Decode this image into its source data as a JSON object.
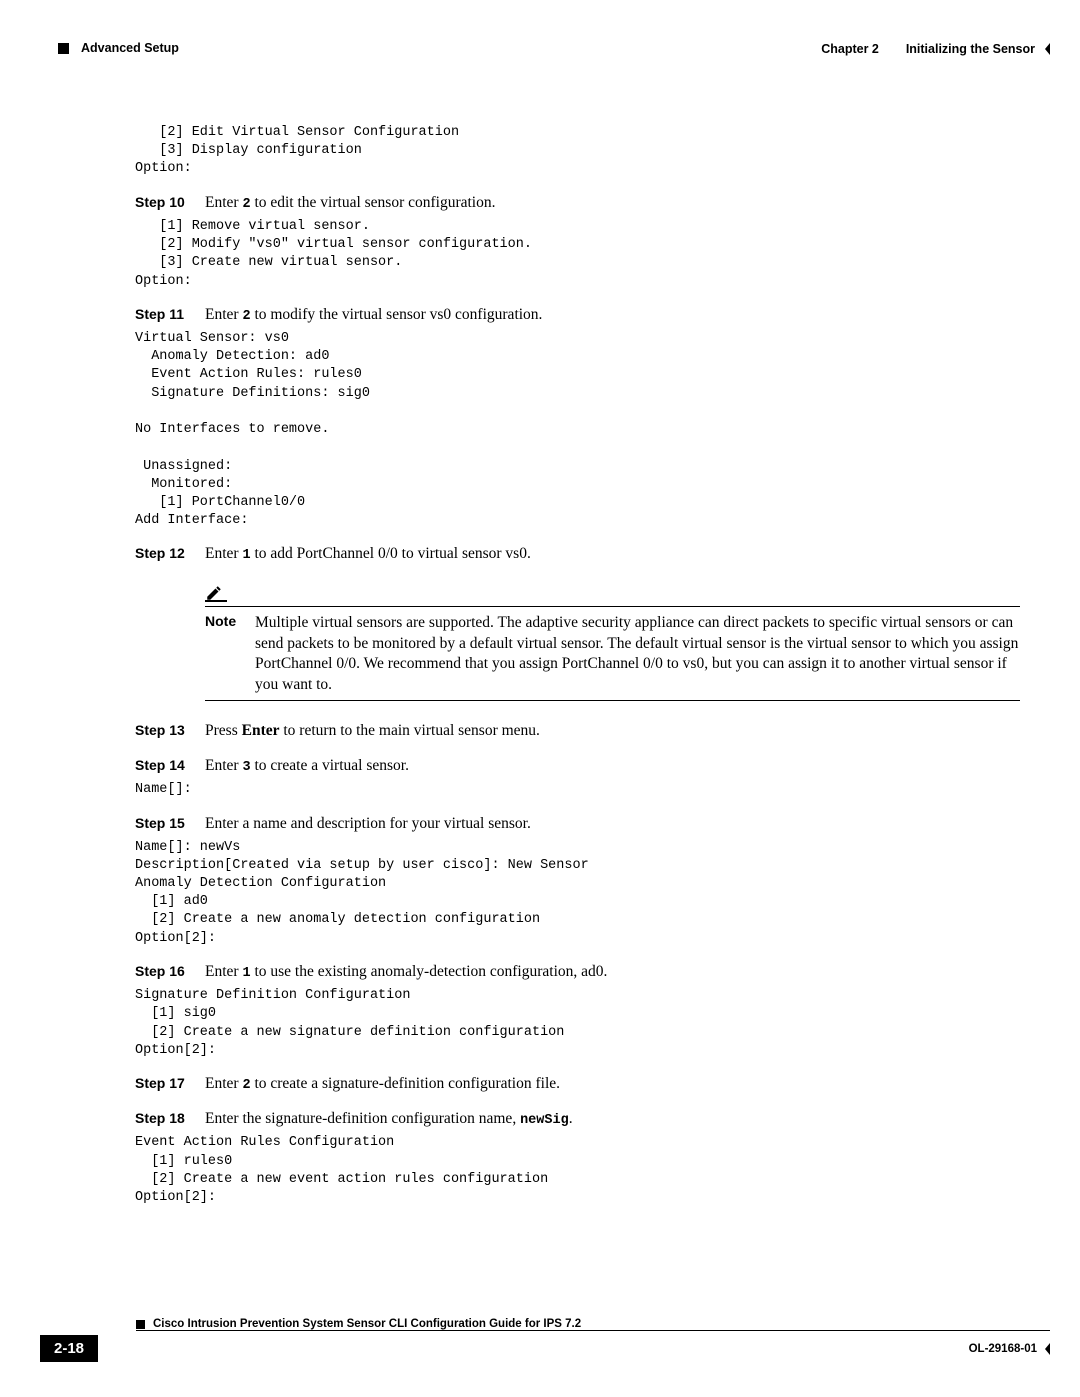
{
  "header": {
    "left": "Advanced Setup",
    "chapter": "Chapter 2",
    "title": "Initializing the Sensor"
  },
  "intro_code": "   [2] Edit Virtual Sensor Configuration\n   [3] Display configuration\nOption:",
  "steps": {
    "s10": {
      "label": "Step 10",
      "text_pre": "Enter ",
      "cmd": "2",
      "text_post": " to edit the virtual sensor configuration.",
      "code": "   [1] Remove virtual sensor.\n   [2] Modify \"vs0\" virtual sensor configuration.\n   [3] Create new virtual sensor.\nOption:"
    },
    "s11": {
      "label": "Step 11",
      "text_pre": "Enter ",
      "cmd": "2",
      "text_post": " to modify the virtual sensor vs0 configuration.",
      "code": "Virtual Sensor: vs0\n  Anomaly Detection: ad0\n  Event Action Rules: rules0\n  Signature Definitions: sig0\n\nNo Interfaces to remove.\n\n Unassigned:\n  Monitored:\n   [1] PortChannel0/0\nAdd Interface:"
    },
    "s12": {
      "label": "Step 12",
      "text_pre": "Enter ",
      "cmd": "1",
      "text_post": " to add PortChannel 0/0 to virtual sensor vs0."
    },
    "note": {
      "label": "Note",
      "text": "Multiple virtual sensors are supported. The adaptive security appliance can direct packets to specific virtual sensors or can send packets to be monitored by a default virtual sensor. The default virtual sensor is the virtual sensor to which you assign PortChannel 0/0. We recommend that you assign PortChannel 0/0 to vs0, but you can assign it to another virtual sensor if you want to."
    },
    "s13": {
      "label": "Step 13",
      "text_pre": "Press ",
      "bold": "Enter",
      "text_post": " to return to the main virtual sensor menu."
    },
    "s14": {
      "label": "Step 14",
      "text_pre": "Enter ",
      "cmd": "3",
      "text_post": " to create a virtual sensor.",
      "code": "Name[]:"
    },
    "s15": {
      "label": "Step 15",
      "text": "Enter a name and description for your virtual sensor.",
      "code": "Name[]: newVs\nDescription[Created via setup by user cisco]: New Sensor\nAnomaly Detection Configuration\n  [1] ad0\n  [2] Create a new anomaly detection configuration\nOption[2]:"
    },
    "s16": {
      "label": "Step 16",
      "text_pre": "Enter ",
      "cmd": "1",
      "text_post": " to use the existing anomaly-detection configuration, ad0.",
      "code": "Signature Definition Configuration\n  [1] sig0\n  [2] Create a new signature definition configuration\nOption[2]:"
    },
    "s17": {
      "label": "Step 17",
      "text_pre": "Enter ",
      "cmd": "2",
      "text_post": " to create a signature-definition configuration file."
    },
    "s18": {
      "label": "Step 18",
      "text_pre": "Enter the signature-definition configuration name, ",
      "cmd": "newSig",
      "text_post": ".",
      "code": "Event Action Rules Configuration\n  [1] rules0\n  [2] Create a new event action rules configuration\nOption[2]:"
    }
  },
  "footer": {
    "guide_title": "Cisco Intrusion Prevention System Sensor CLI Configuration Guide for IPS 7.2",
    "page_num": "2-18",
    "doc_id": "OL-29168-01"
  }
}
